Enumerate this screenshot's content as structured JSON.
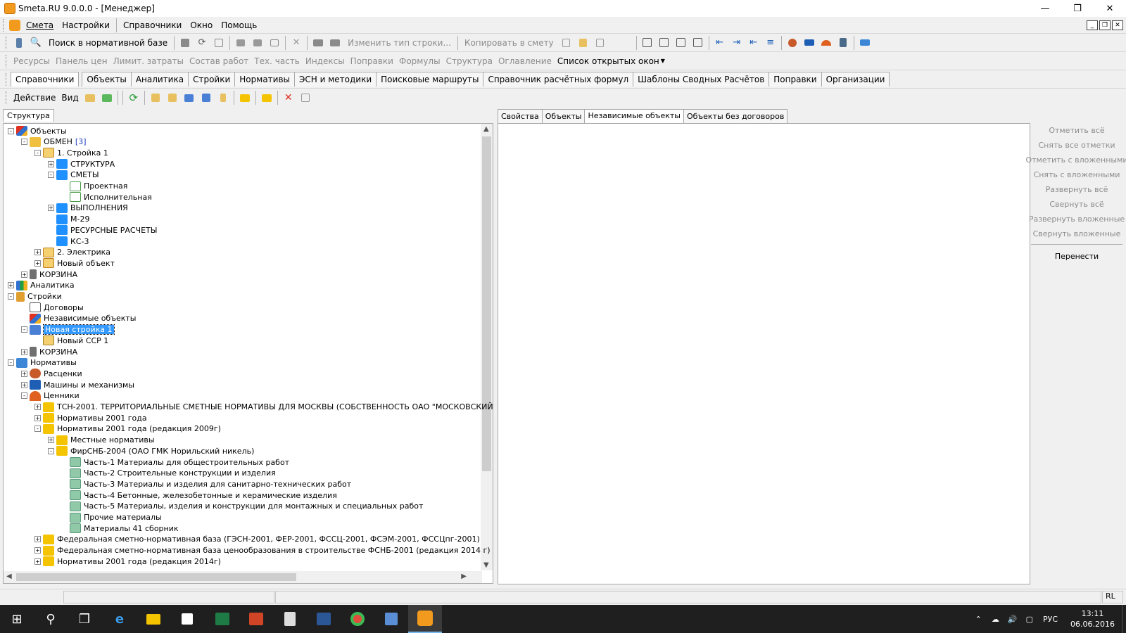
{
  "window": {
    "title": "Smeta.RU  9.0.0.0   - [Менеджер]",
    "minimize_icon": "minimize-icon",
    "maximize_icon": "maximize-icon",
    "close_icon": "close-icon"
  },
  "menu": {
    "items": [
      "Смета",
      "Настройки",
      "Справочники",
      "Окно",
      "Помощь"
    ]
  },
  "toolbar1": {
    "search_label": "Поиск в нормативной базе",
    "change_row_type": "Изменить тип строки...",
    "copy_to_estimate": "Копировать в смету",
    "open_windows": "Список открытых окон"
  },
  "toolbar2": {
    "items": [
      "Ресурсы",
      "Панель цен",
      "Лимит. затраты",
      "Состав работ",
      "Тех. часть",
      "Индексы",
      "Поправки",
      "Формулы",
      "Структура",
      "Оглавление"
    ]
  },
  "tabs": {
    "items": [
      "Справочники",
      "Объекты",
      "Аналитика",
      "Стройки",
      "Нормативы",
      "ЭСН и методики",
      "Поисковые маршруты",
      "Справочник расчётных формул",
      "Шаблоны Сводных Расчётов",
      "Поправки",
      "Организации"
    ],
    "active": 0
  },
  "toolbar4": {
    "action": "Действие",
    "view": "Вид"
  },
  "left_panel": {
    "tab": "Структура"
  },
  "tree": [
    {
      "label": "Объекты",
      "level": 0,
      "exp": "-",
      "icon": "objects-icon"
    },
    {
      "label": "ОБМЕН",
      "count": "[3]",
      "level": 1,
      "exp": "-",
      "icon": "exchange-folder-icon"
    },
    {
      "label": "1. Стройка 1",
      "level": 2,
      "exp": "-",
      "icon": "building-icon"
    },
    {
      "label": "СТРУКТУРА",
      "level": 3,
      "exp": "+",
      "icon": "blue-folder-icon"
    },
    {
      "label": "СМЕТЫ",
      "level": 3,
      "exp": "-",
      "icon": "blue-folder-icon"
    },
    {
      "label": "Проектная",
      "level": 4,
      "exp": "",
      "icon": "estimate-icon"
    },
    {
      "label": "Исполнительная",
      "level": 4,
      "exp": "",
      "icon": "estimate-icon"
    },
    {
      "label": "ВЫПОЛНЕНИЯ",
      "level": 3,
      "exp": "+",
      "icon": "blue-folder-icon"
    },
    {
      "label": "М-29",
      "level": 3,
      "exp": "",
      "icon": "blue-folder-icon"
    },
    {
      "label": "РЕСУРСНЫЕ РАСЧЕТЫ",
      "level": 3,
      "exp": "",
      "icon": "blue-folder-icon"
    },
    {
      "label": "КС-3",
      "level": 3,
      "exp": "",
      "icon": "blue-folder-icon"
    },
    {
      "label": "2. Электрика",
      "level": 2,
      "exp": "+",
      "icon": "building-icon"
    },
    {
      "label": "Новый объект",
      "level": 2,
      "exp": "+",
      "icon": "building-icon"
    },
    {
      "label": "КОРЗИНА",
      "level": 1,
      "exp": "+",
      "icon": "trash-icon"
    },
    {
      "label": "Аналитика",
      "level": 0,
      "exp": "+",
      "icon": "analytics-icon"
    },
    {
      "label": "Стройки",
      "level": 0,
      "exp": "-",
      "icon": "crane-icon"
    },
    {
      "label": "Договоры",
      "level": 1,
      "exp": "",
      "icon": "contracts-icon"
    },
    {
      "label": "Независимые объекты",
      "level": 1,
      "exp": "",
      "icon": "objects-icon"
    },
    {
      "label": "Новая стройка 1",
      "level": 1,
      "exp": "-",
      "icon": "site-icon",
      "selected": true
    },
    {
      "label": "Новый ССР 1",
      "level": 2,
      "exp": "",
      "icon": "ssr-icon"
    },
    {
      "label": "КОРЗИНА",
      "level": 1,
      "exp": "+",
      "icon": "trash-icon"
    },
    {
      "label": "Нормативы",
      "level": 0,
      "exp": "-",
      "icon": "norms-icon"
    },
    {
      "label": "Расценки",
      "level": 1,
      "exp": "+",
      "icon": "rates-icon"
    },
    {
      "label": "Машины и механизмы",
      "level": 1,
      "exp": "+",
      "icon": "machines-icon"
    },
    {
      "label": "Ценники",
      "level": 1,
      "exp": "-",
      "icon": "pricelists-icon"
    },
    {
      "label": "ТСН-2001. ТЕРРИТОРИАЛЬНЫЕ СМЕТНЫЕ НОРМАТИВЫ ДЛЯ МОСКВЫ (СОБСТВЕННОСТЬ ОАО \"МОСКОВСКИЙ",
      "level": 2,
      "exp": "+",
      "icon": "yellow-folder-icon"
    },
    {
      "label": "Нормативы 2001 года",
      "level": 2,
      "exp": "+",
      "icon": "yellow-folder-icon"
    },
    {
      "label": "Нормативы 2001 года (редакция 2009г)",
      "level": 2,
      "exp": "-",
      "icon": "yellow-folder-icon"
    },
    {
      "label": "Местные нормативы",
      "level": 3,
      "exp": "+",
      "icon": "yellow-folder-icon"
    },
    {
      "label": "ФирСНБ-2004 (ОАО ГМК Норильский никель)",
      "level": 3,
      "exp": "-",
      "icon": "yellow-folder-icon"
    },
    {
      "label": "Часть-1 Материалы для общестроительных работ",
      "level": 4,
      "exp": "",
      "icon": "book-icon"
    },
    {
      "label": "Часть-2 Строительные конструкции и изделия",
      "level": 4,
      "exp": "",
      "icon": "book-icon"
    },
    {
      "label": "Часть-3 Материалы и изделия для санитарно-технических работ",
      "level": 4,
      "exp": "",
      "icon": "book-icon"
    },
    {
      "label": "Часть-4 Бетонные, железобетонные и керамические изделия",
      "level": 4,
      "exp": "",
      "icon": "book-icon"
    },
    {
      "label": "Часть-5 Материалы, изделия и конструкции для монтажных и специальных работ",
      "level": 4,
      "exp": "",
      "icon": "book-icon"
    },
    {
      "label": "Прочие материалы",
      "level": 4,
      "exp": "",
      "icon": "book-icon"
    },
    {
      "label": "Материалы 41 сборник",
      "level": 4,
      "exp": "",
      "icon": "book-icon"
    },
    {
      "label": "Федеральная сметно-нормативная база (ГЭСН-2001, ФЕР-2001, ФССЦ-2001, ФСЭМ-2001, ФССЦпг-2001)",
      "level": 2,
      "exp": "+",
      "icon": "yellow-folder-icon"
    },
    {
      "label": "Федеральная сметно-нормативная база ценообразования в строительстве ФСНБ-2001 (редакция 2014 г)",
      "level": 2,
      "exp": "+",
      "icon": "yellow-folder-icon"
    },
    {
      "label": "Нормативы 2001 года (редакция 2014г)",
      "level": 2,
      "exp": "+",
      "icon": "yellow-folder-icon"
    }
  ],
  "right_tabs": {
    "items": [
      "Свойства",
      "Объекты",
      "Независимые объекты",
      "Объекты без договоров"
    ],
    "active": 2
  },
  "side_buttons": {
    "items": [
      "Отметить всё",
      "Снять все отметки",
      "Отметить с вложенными",
      "Снять с вложенными",
      "Развернуть всё",
      "Свернуть всё",
      "Развернуть вложенные",
      "Свернуть вложенные"
    ],
    "move": "Перенести"
  },
  "status": {
    "right": "RL"
  },
  "taskbar": {
    "lang": "РУС",
    "time": "13:11",
    "date": "06.06.2016"
  },
  "colors": {
    "accent": "#f29a1e",
    "selection": "#3399ff",
    "blue_folder": "#1e90ff",
    "yellow_folder": "#f5c400"
  }
}
